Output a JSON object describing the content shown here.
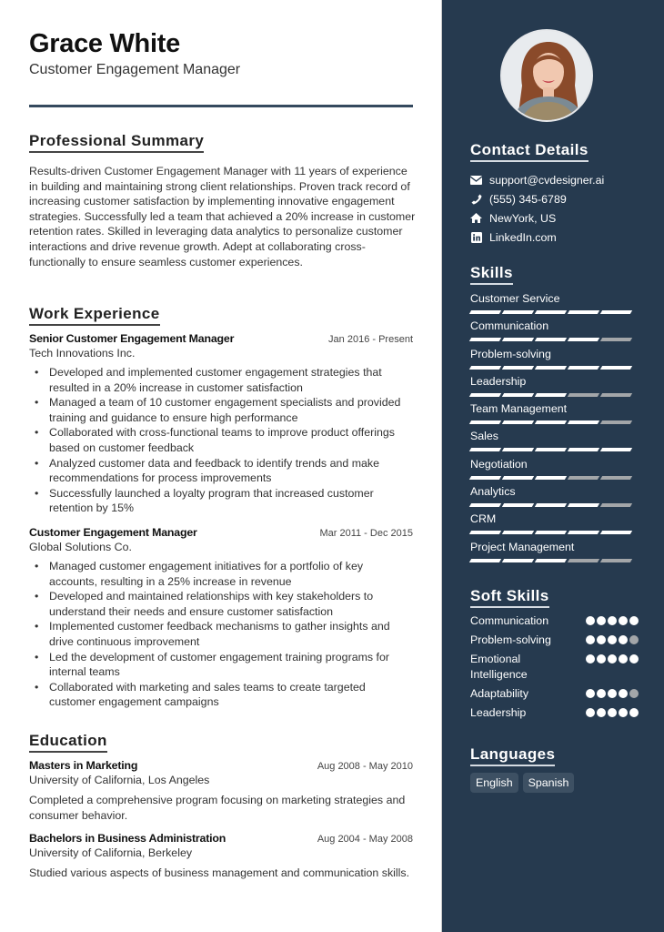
{
  "header": {
    "name": "Grace White",
    "title": "Customer Engagement Manager"
  },
  "summary": {
    "heading": "Professional Summary",
    "text": "Results-driven Customer Engagement Manager with 11 years of experience in building and maintaining strong client relationships. Proven track record of increasing customer satisfaction by implementing innovative engagement strategies. Successfully led a team that achieved a 20% increase in customer retention rates. Skilled in leveraging data analytics to personalize customer interactions and drive revenue growth. Adept at collaborating cross-functionally to ensure seamless customer experiences."
  },
  "experience": {
    "heading": "Work Experience",
    "jobs": [
      {
        "role": "Senior Customer Engagement Manager",
        "dates": "Jan 2016 - Present",
        "company": "Tech Innovations Inc.",
        "bullets": [
          "Developed and implemented customer engagement strategies that resulted in a 20% increase in customer satisfaction",
          "Managed a team of 10 customer engagement specialists and provided training and guidance to ensure high performance",
          "Collaborated with cross-functional teams to improve product offerings based on customer feedback",
          "Analyzed customer data and feedback to identify trends and make recommendations for process improvements",
          "Successfully launched a loyalty program that increased customer retention by 15%"
        ]
      },
      {
        "role": "Customer Engagement Manager",
        "dates": "Mar 2011 - Dec 2015",
        "company": "Global Solutions Co.",
        "bullets": [
          "Managed customer engagement initiatives for a portfolio of key accounts, resulting in a 25% increase in revenue",
          "Developed and maintained relationships with key stakeholders to understand their needs and ensure customer satisfaction",
          "Implemented customer feedback mechanisms to gather insights and drive continuous improvement",
          "Led the development of customer engagement training programs for internal teams",
          "Collaborated with marketing and sales teams to create targeted customer engagement campaigns"
        ]
      }
    ]
  },
  "education": {
    "heading": "Education",
    "items": [
      {
        "degree": "Masters in Marketing",
        "dates": "Aug 2008 - May 2010",
        "school": "University of California, Los Angeles",
        "description": "Completed a comprehensive program focusing on marketing strategies and consumer behavior."
      },
      {
        "degree": "Bachelors in Business Administration",
        "dates": "Aug 2004 - May 2008",
        "school": "University of California, Berkeley",
        "description": "Studied various aspects of business management and communication skills."
      }
    ]
  },
  "contact": {
    "heading": "Contact Details",
    "items": [
      {
        "icon": "envelope-icon",
        "text": "support@cvdesigner.ai"
      },
      {
        "icon": "phone-icon",
        "text": "(555) 345-6789"
      },
      {
        "icon": "home-icon",
        "text": "NewYork, US"
      },
      {
        "icon": "linkedin-icon",
        "text": "LinkedIn.com"
      }
    ]
  },
  "skills": {
    "heading": "Skills",
    "max_level": 5,
    "items": [
      {
        "name": "Customer Service",
        "level": 5
      },
      {
        "name": "Communication",
        "level": 4
      },
      {
        "name": "Problem-solving",
        "level": 5
      },
      {
        "name": "Leadership",
        "level": 3
      },
      {
        "name": "Team Management",
        "level": 4
      },
      {
        "name": "Sales",
        "level": 5
      },
      {
        "name": "Negotiation",
        "level": 3
      },
      {
        "name": "Analytics",
        "level": 4
      },
      {
        "name": "CRM",
        "level": 5
      },
      {
        "name": "Project Management",
        "level": 3
      }
    ]
  },
  "soft_skills": {
    "heading": "Soft Skills",
    "max_level": 5,
    "items": [
      {
        "name": "Communication",
        "level": 5
      },
      {
        "name": "Problem-solving",
        "level": 4
      },
      {
        "name": "Emotional Intelligence",
        "level": 5
      },
      {
        "name": "Adaptability",
        "level": 4
      },
      {
        "name": "Leadership",
        "level": 5
      }
    ]
  },
  "languages": {
    "heading": "Languages",
    "items": [
      "English",
      "Spanish"
    ]
  },
  "colors": {
    "sidebar_bg": "#263a4f",
    "rating_on": "#ffffff",
    "rating_off": "#a3a6a9",
    "chip_bg": "#3d5063"
  }
}
